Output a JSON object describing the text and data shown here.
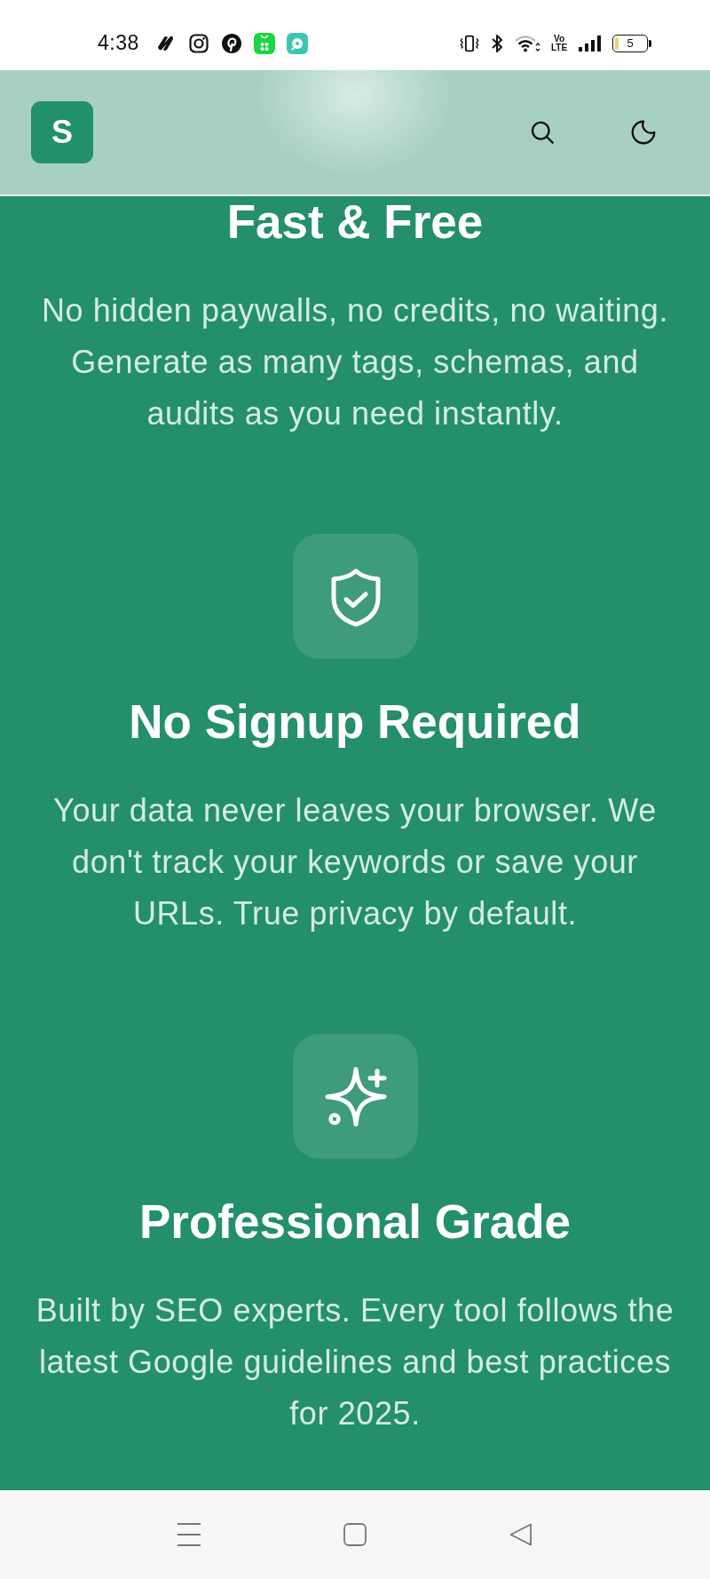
{
  "status_bar": {
    "time": "4:38",
    "network_label": "Vo LTE",
    "battery_text": "5"
  },
  "header": {
    "logo_letter": "S"
  },
  "features": [
    {
      "kind": "text",
      "title": "Fast & Free",
      "description": "No hidden paywalls, no credits, no waiting. Generate as many tags, schemas, and audits as you need instantly."
    },
    {
      "kind": "icon-tile",
      "title": "No Signup Required",
      "description": "Your data never leaves your browser. We don't track your keywords or save your URLs. True privacy by default."
    },
    {
      "kind": "icon-tile",
      "title": "Professional Grade",
      "description": "Built by SEO experts. Every tool follows the latest Google guidelines and best practices for 2025."
    }
  ]
}
